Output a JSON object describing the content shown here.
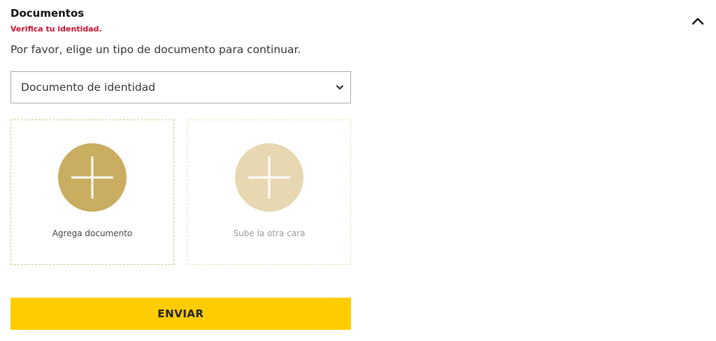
{
  "section": {
    "title": "Documentos",
    "warning": "Verifica tu identidad.",
    "toggle_icon": "chevron-up-icon"
  },
  "instruction": "Por favor, elige un tipo de documento para continuar.",
  "document_select": {
    "selected": "Documento de identidad",
    "icon": "chevron-down-icon"
  },
  "upload_cards": {
    "front": {
      "label": "Agrega documento",
      "icon": "plus-icon",
      "color": "#c9ad61"
    },
    "back": {
      "label": "Sube la otra cara",
      "icon": "plus-icon",
      "color": "#e8d8b2"
    }
  },
  "submit": {
    "label": "ENVIAR",
    "color": "#ffcc00"
  },
  "colors": {
    "warning": "#c8102e"
  }
}
